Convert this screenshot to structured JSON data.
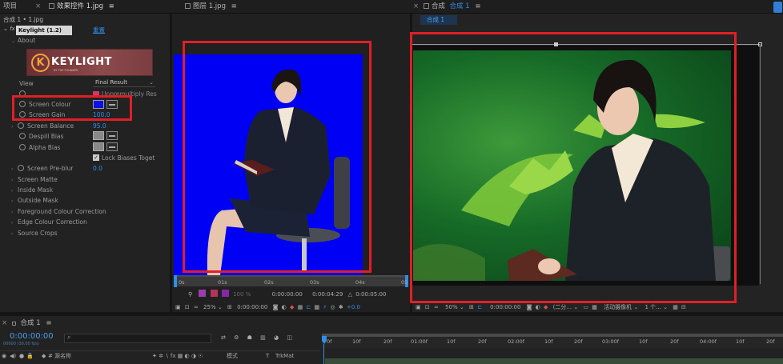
{
  "tabs": {
    "project": "项目",
    "effect_controls": "效果控件 1.jpg",
    "layer": "图层 1.jpg",
    "composition_prefix": "合成",
    "composition_name": "合成 1",
    "comp_subtab": "合成 1"
  },
  "effect_controls": {
    "breadcrumb": "合成 1 • 1.jpg",
    "effect_name": "Keylight (1.2)",
    "reset": "重置",
    "about": "About",
    "logo_text": "KEYLIGHT",
    "logo_subtext": "BY THE FOUNDRY",
    "view_label": "View",
    "view_value": "Final Result",
    "unpremultiply": "Unpremultiply Res",
    "screen_colour": "Screen Colour",
    "screen_colour_value": "#0a10e8",
    "screen_gain": "Screen Gain",
    "screen_gain_value": "100.0",
    "screen_balance": "Screen Balance",
    "screen_balance_value": "95.0",
    "despill_bias": "Despill Bias",
    "alpha_bias": "Alpha Bias",
    "lock_biases": "Lock Biases Toget",
    "screen_preblur": "Screen Pre-blur",
    "screen_preblur_value": "0.0",
    "groups": [
      "Screen Matte",
      "Inside Mask",
      "Outside Mask",
      "Foreground Colour Correction",
      "Edge Colour Correction",
      "Source Crops"
    ]
  },
  "layer_panel": {
    "ruler_ticks": [
      "0s",
      "01s",
      "02s",
      "03s",
      "04s",
      "05"
    ],
    "time_left": "0:00:00:00",
    "time_right": "0:00:04:29",
    "time_end": "0:00:05:00",
    "zoom": "25%",
    "percent": "100 %",
    "time_current": "0:00:00:00",
    "offset": "+0.0"
  },
  "comp_panel": {
    "zoom": "50%",
    "time_current": "0:00:00:00",
    "resolution": "(二分...",
    "camera": "活动摄像机",
    "views": "1 个..."
  },
  "timeline": {
    "comp_tab": "合成 1",
    "timecode": "0:00:00:00",
    "timecode_sub": "00000 (30.00 fps)",
    "search_placeholder": "",
    "col_source": "源名称",
    "col_mode": "模式",
    "col_t": "T",
    "col_trkmat": "TrkMat",
    "ruler": [
      "0f",
      "10f",
      "20f",
      "01:00f",
      "10f",
      "20f",
      "02:00f",
      "10f",
      "20f",
      "03:00f",
      "10f",
      "20f",
      "04:00f",
      "10f",
      "20f"
    ]
  }
}
